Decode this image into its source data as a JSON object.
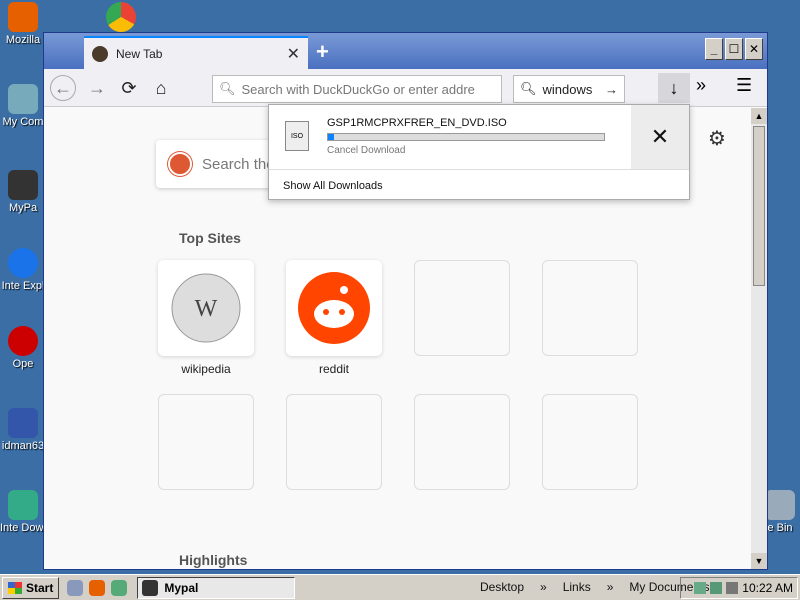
{
  "desktop": {
    "icons": [
      {
        "label": "Mozilla",
        "color": "#e66000"
      },
      {
        "label": "My Com",
        "color": "#7ab"
      },
      {
        "label": "MyPa",
        "color": "#333"
      },
      {
        "label": "Inte Expl",
        "color": "#1a73e8"
      },
      {
        "label": "Ope",
        "color": "#c00"
      },
      {
        "label": "idman63",
        "color": "#3355aa"
      },
      {
        "label": "Inte Down",
        "color": "#3a8"
      }
    ],
    "chrome_icon": {
      "color": "#34a853"
    },
    "recycle_label": "e Bin"
  },
  "browser": {
    "tab_title": "New Tab",
    "tab_close": "✕",
    "new_tab": "+",
    "window_buttons": [
      "_",
      "☐",
      "✕"
    ],
    "url_placeholder": "Search with DuckDuckGo or enter addre",
    "search_value": "windows",
    "accent": "#0a84ff"
  },
  "newtab": {
    "search_placeholder": "Search the",
    "top_sites_title": "Top Sites",
    "highlights_title": "Highlights",
    "sites": [
      {
        "label": "wikipedia"
      },
      {
        "label": "reddit"
      }
    ]
  },
  "downloads": {
    "file_name": "GSP1RMCPRXFRER_EN_DVD.ISO",
    "status": "Cancel Download",
    "progress": 0.02,
    "show_all": "Show All Downloads",
    "icon_text": "ISO"
  },
  "taskbar": {
    "start": "Start",
    "task_label": "Mypal",
    "links": [
      "Desktop",
      "Links",
      "My Documents"
    ],
    "clock": "10:22 AM"
  }
}
